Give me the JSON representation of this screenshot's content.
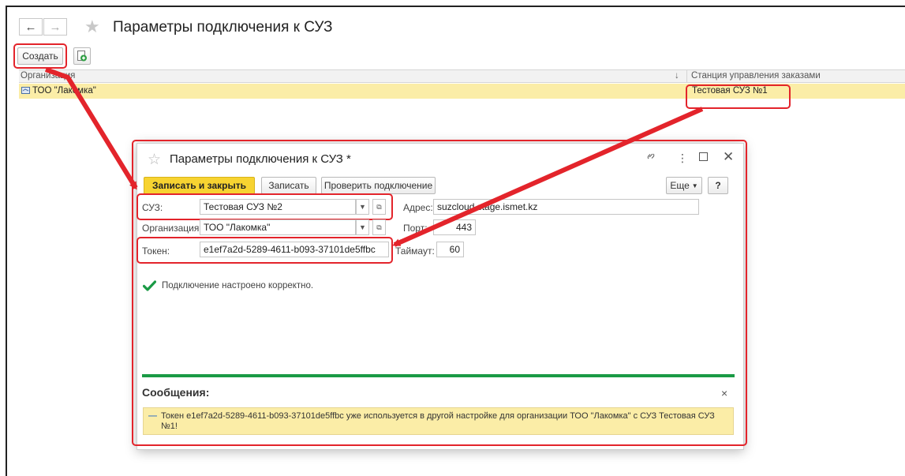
{
  "window": {
    "title": "Параметры подключения к СУЗ",
    "create_label": "Создать"
  },
  "list": {
    "col_org": "Организация",
    "col_station": "Станция управления заказами",
    "sort_arrow": "↓",
    "rows": [
      {
        "org": "ТОО \"Лакомка\"",
        "station": "Тестовая СУЗ №1"
      }
    ]
  },
  "dialog": {
    "title": "Параметры подключения к СУЗ *",
    "btn_save_close": "Записать и закрыть",
    "btn_save": "Записать",
    "btn_check": "Проверить подключение",
    "btn_more": "Еще",
    "btn_help": "?",
    "fields": {
      "suz_label": "СУЗ:",
      "suz_value": "Тестовая СУЗ №2",
      "address_label": "Адрес:",
      "address_value": "suzcloud.stage.ismet.kz",
      "org_label": "Организация:",
      "org_value": "ТОО \"Лакомка\"",
      "port_label": "Порт:",
      "port_value": "443",
      "token_label": "Токен:",
      "token_value": "e1ef7a2d-5289-4611-b093-37101de5ffbc",
      "timeout_label": "Таймаут:",
      "timeout_value": "60"
    },
    "status_text": "Подключение настроено корректно.",
    "messages_title": "Сообщения:",
    "message_text": "Токен e1ef7a2d-5289-4611-b093-37101de5ffbc уже используется в другой настройке для организации ТОО \"Лакомка\" с СУЗ Тестовая СУЗ №1!"
  },
  "colors": {
    "accent_yellow": "#f7d331",
    "selected_row": "#fbeda7",
    "annotation_red": "#e3242b",
    "success_green": "#1a9a45"
  }
}
